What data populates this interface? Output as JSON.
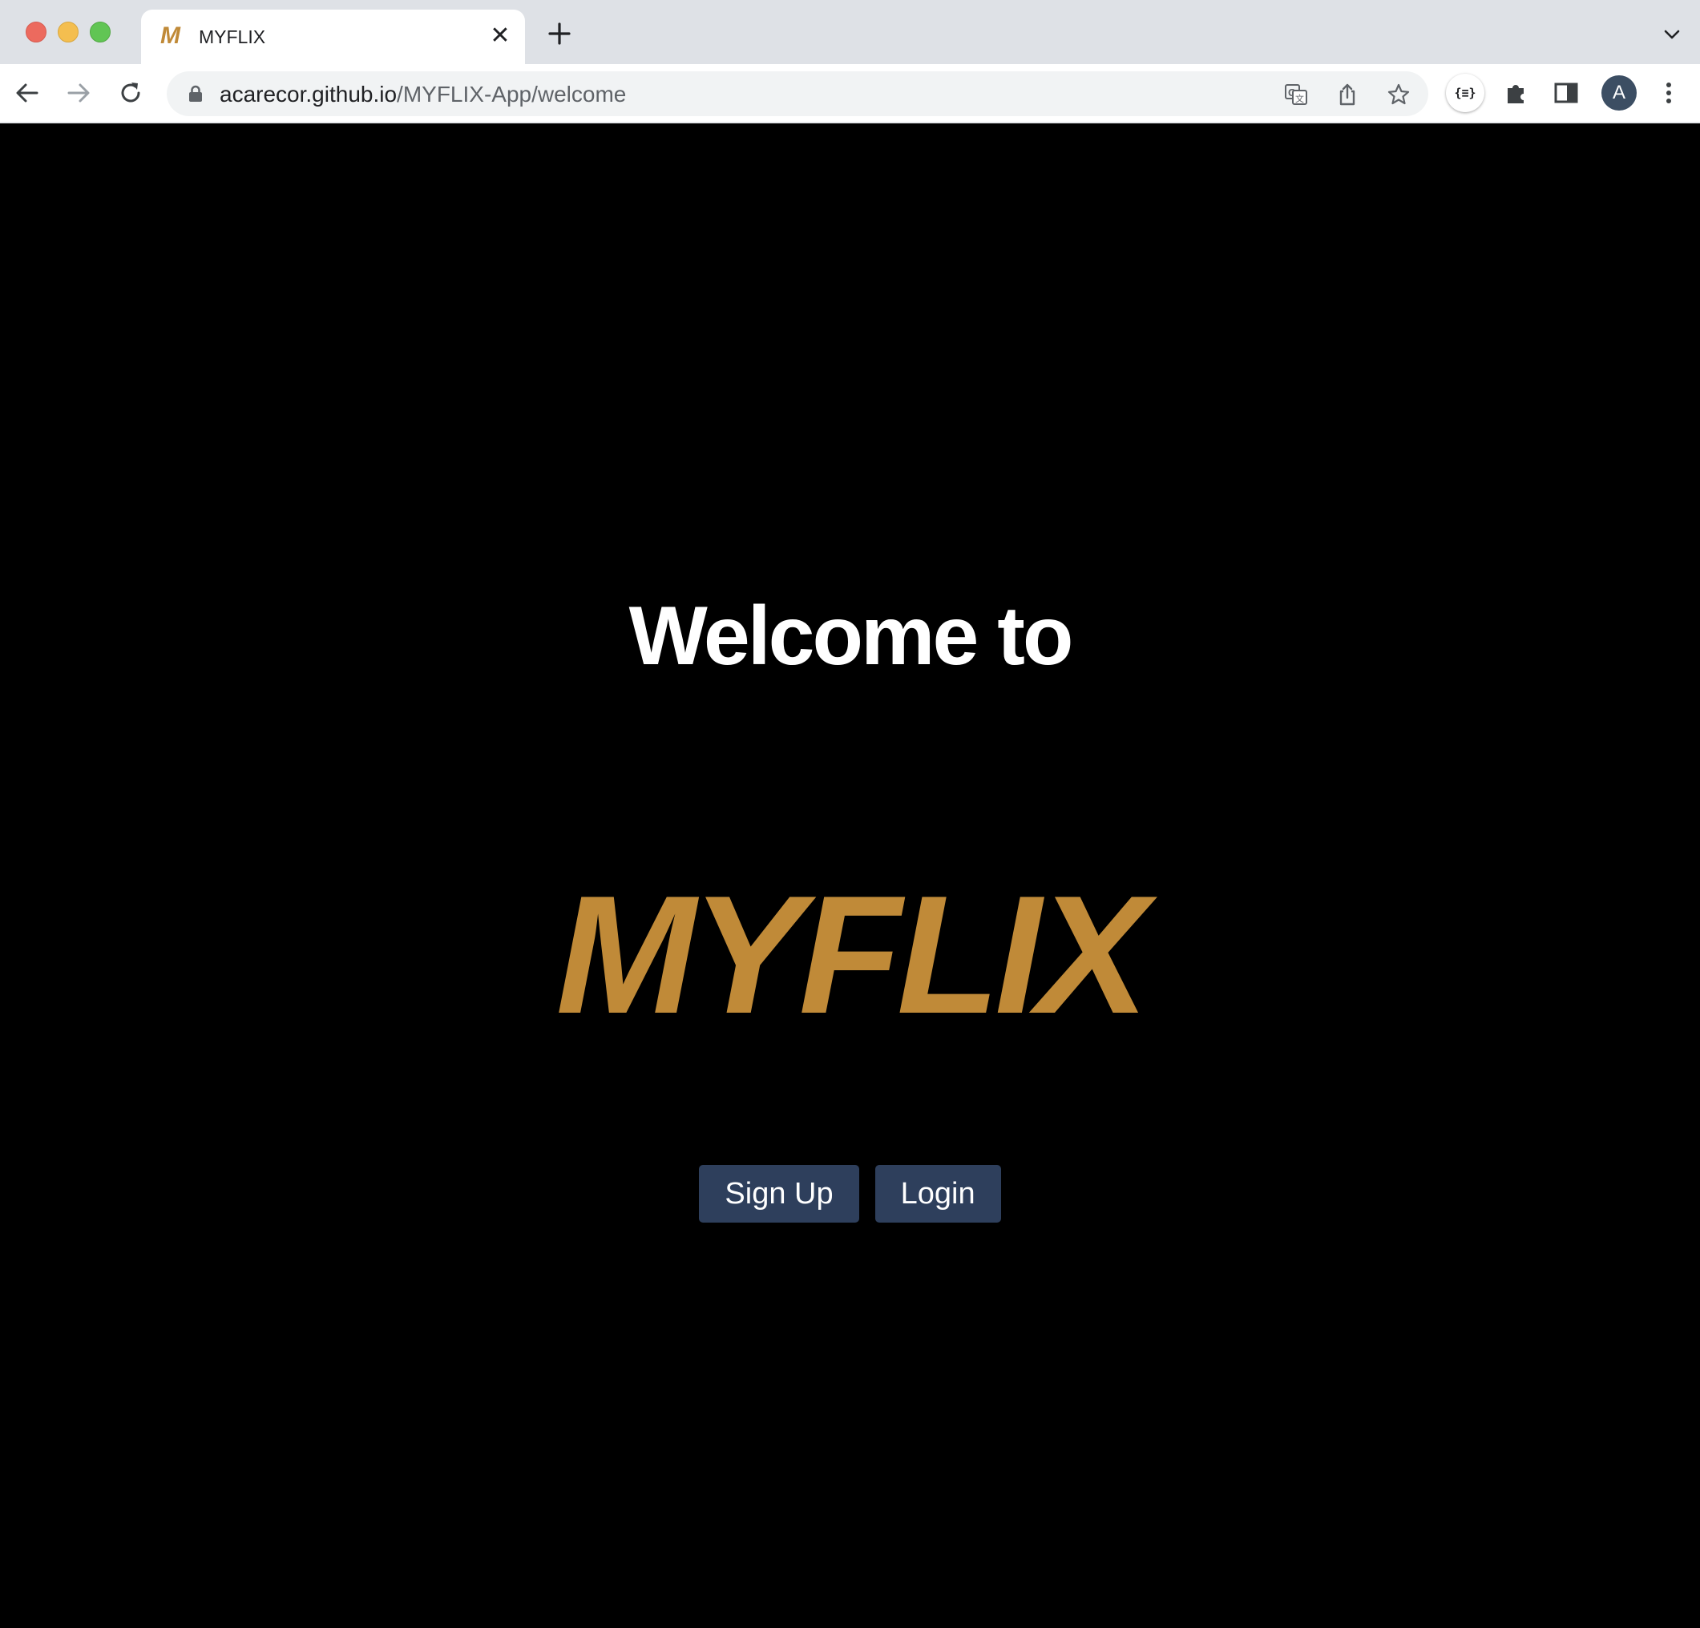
{
  "browser": {
    "tab": {
      "favicon_letter": "M",
      "title": "MYFLIX",
      "close_glyph": "✕"
    },
    "address_bar": {
      "host": "acarecor.github.io",
      "path": "/MYFLIX-App/welcome"
    },
    "extension_json_label": "{≡}",
    "profile_initial": "A",
    "icons": {
      "back": "back-arrow-icon",
      "forward": "forward-arrow-icon",
      "reload": "reload-icon",
      "lock": "lock-icon",
      "translate": "translate-icon",
      "share": "share-icon",
      "bookmark": "star-icon",
      "extensions": "puzzle-icon",
      "side_panel": "side-panel-icon",
      "menu": "kebab-menu-icon"
    }
  },
  "page": {
    "welcome_text": "Welcome to",
    "logo_text": "MYFLIX",
    "buttons": {
      "signup": "Sign Up",
      "login": "Login"
    }
  },
  "colors": {
    "background": "#000000",
    "logo_gold": "#c08a38",
    "button_navy": "#2e3f5c"
  }
}
